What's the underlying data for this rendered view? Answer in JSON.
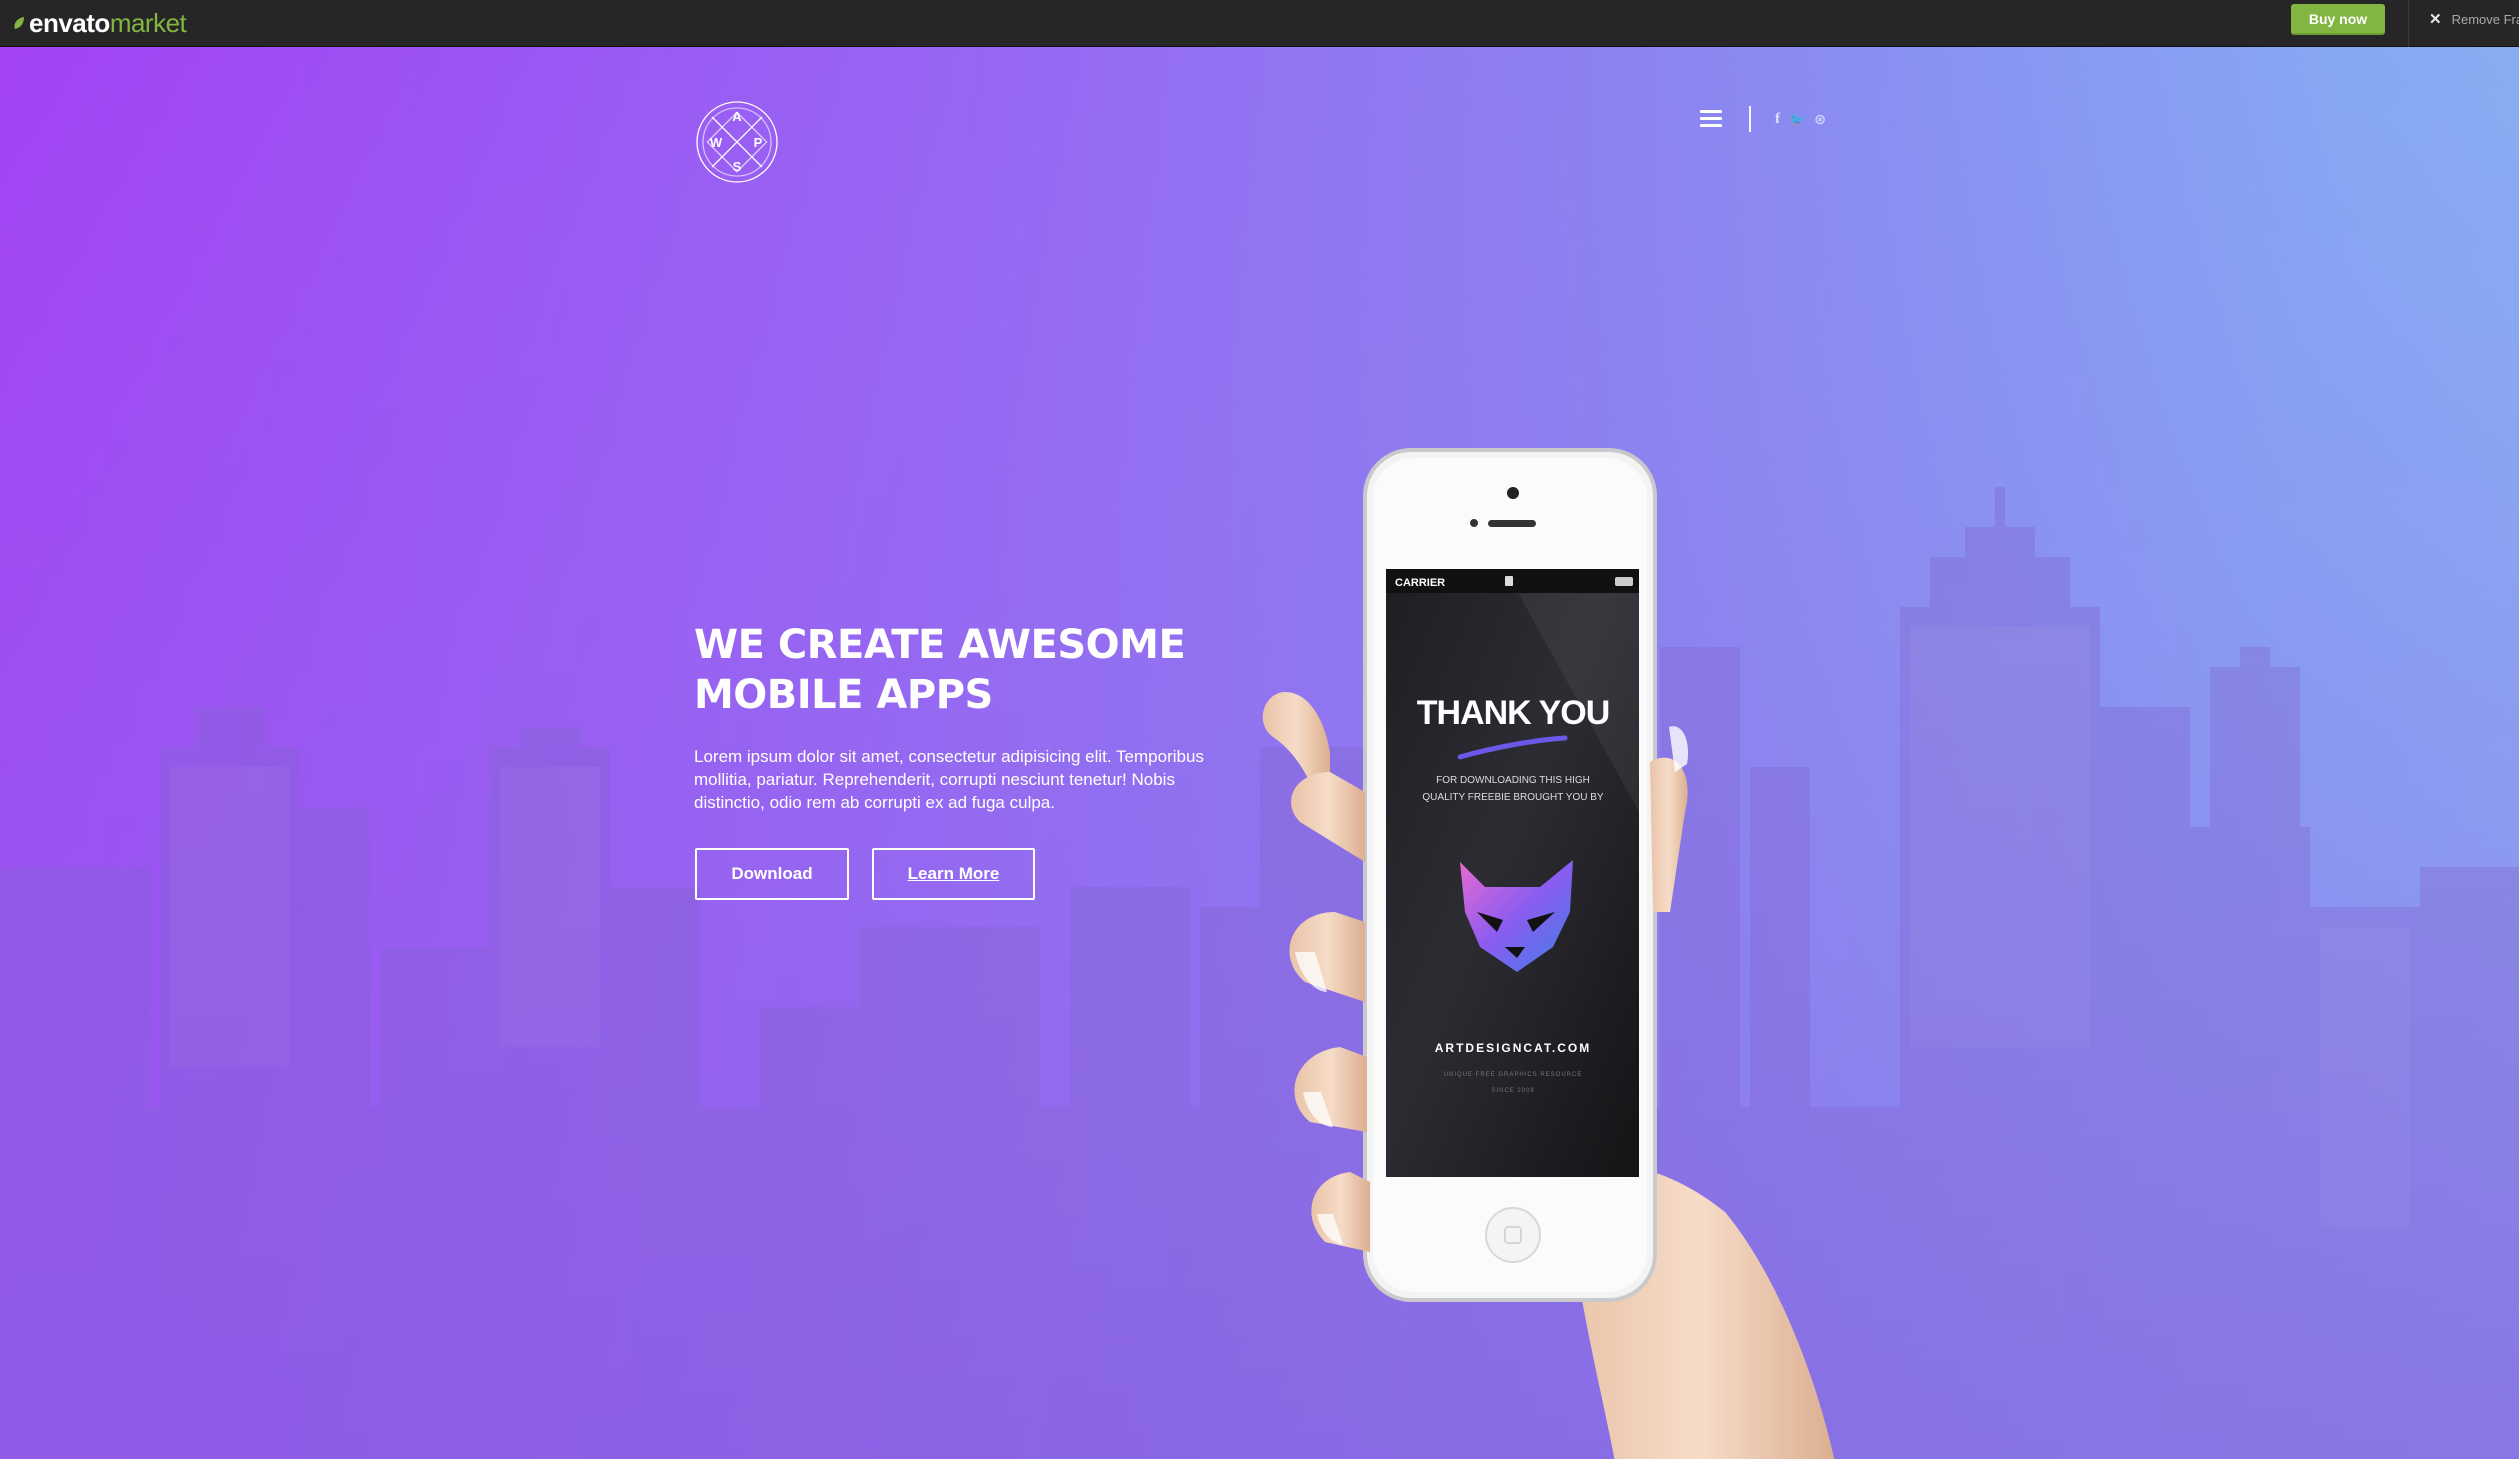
{
  "topbar": {
    "brand_bold": "envato",
    "brand_light": "market",
    "buy_label": "Buy now",
    "remove_label": "Remove Fra",
    "accent": "#82b541"
  },
  "hero": {
    "logo_letters": {
      "top": "A",
      "left": "W",
      "right": "P",
      "bottom": "S"
    },
    "headline_line1": "WE CREATE AWESOME",
    "headline_line2": "MOBILE APPS",
    "lead": "Lorem ipsum dolor sit amet, consectetur adipisicing elit. Temporibus mollitia, pariatur. Reprehenderit, corrupti nesciunt tenetur! Nobis distinctio, odio rem ab corrupti ex ad fuga culpa.",
    "download_label": "Download",
    "learn_more_label": "Learn More",
    "social": {
      "facebook": "f",
      "twitter": "🐦",
      "dribbble": "⊛"
    },
    "gradient": [
      "#a243f5",
      "#8ab4f2"
    ]
  },
  "phone": {
    "carrier": "CARRIER",
    "thank_you": "THANK YOU",
    "subtitle_line1": "FOR DOWNLOADING THIS HIGH",
    "subtitle_line2": "QUALITY FREEBIE BROUGHT YOU BY",
    "site": "ARTDESIGNCAT.COM",
    "tagline": "UNIQUE FREE GRAPHICS RESOURCE",
    "since": "SINCE 2009"
  }
}
